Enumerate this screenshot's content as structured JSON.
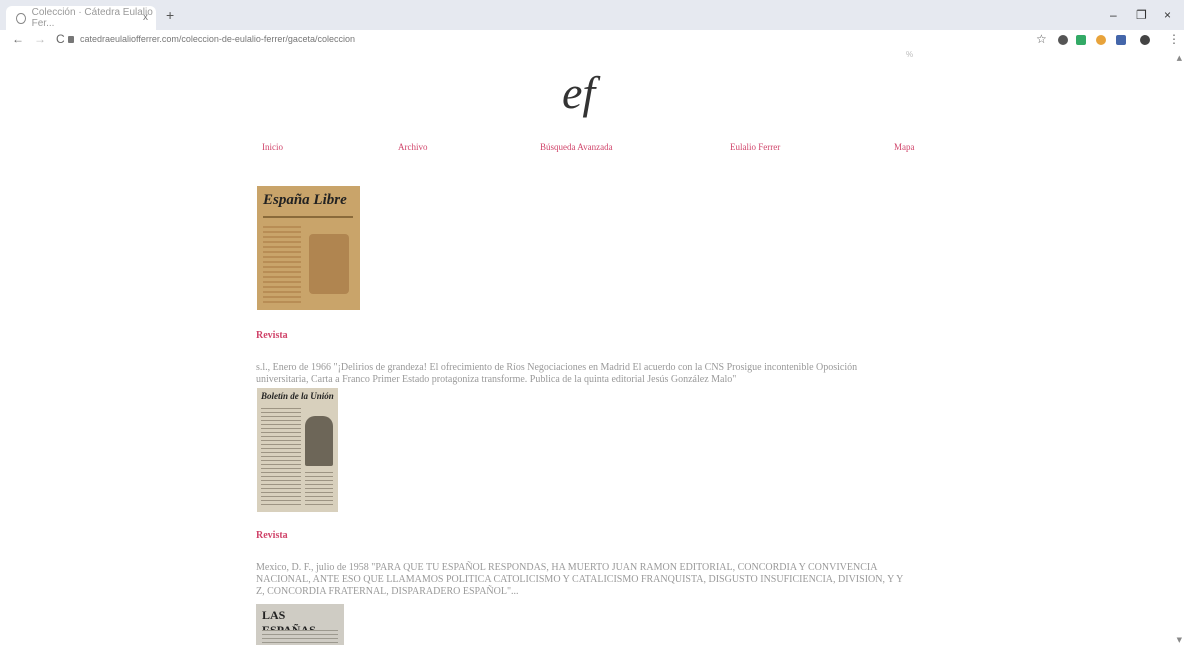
{
  "browser": {
    "tab_title": "Colección · Cátedra Eulalio Fer...",
    "tab_close": "x",
    "new_tab": "+",
    "url": "catedraeulaliofferrer.com/coleccion-de-eulalio-ferrer/gaceta/coleccion",
    "zoom_badge": "%",
    "controls": {
      "minimize": "–",
      "restore": "❐",
      "close": "×"
    },
    "nav": {
      "back": "←",
      "forward": "→",
      "reload": "C"
    },
    "star": "☆",
    "menu_dots": "⋮"
  },
  "site": {
    "logo": "ef",
    "menu": [
      "Inicio",
      "Archivo",
      "Búsqueda Avanzada",
      "Eulalio Ferrer",
      "Mapa"
    ]
  },
  "items": [
    {
      "mast": "España Libre",
      "category": "Revista",
      "description": "s.l., Enero de 1966 \"¡Delirios de grandeza! El ofrecimiento de Ríos Negociaciones en Madrid El acuerdo con la CNS Prosigue incontenible Oposición universitaria, Carta a Franco Primer Estado protagoniza transforme. Publica de la quinta editorial Jesús González Malo\""
    },
    {
      "mast": "Boletín de la Unión",
      "category": "Revista",
      "description": "Mexico, D. F., julio de 1958 \"PARA QUE TU ESPAÑOL RESPONDAS, HA MUERTO JUAN RAMON EDITORIAL, CONCORDIA Y CONVIVENCIA NACIONAL, ANTE ESO QUE LLAMAMOS POLITICA CATOLICISMO Y CATALICISMO FRANQUISTA, DISGUSTO INSUFICIENCIA, DIVISION, Y Y Z, CONCORDIA FRATERNAL, DISPARADERO ESPAÑOL\"..."
    },
    {
      "mast": "LAS ESPAÑAS",
      "category": "",
      "description": ""
    }
  ]
}
